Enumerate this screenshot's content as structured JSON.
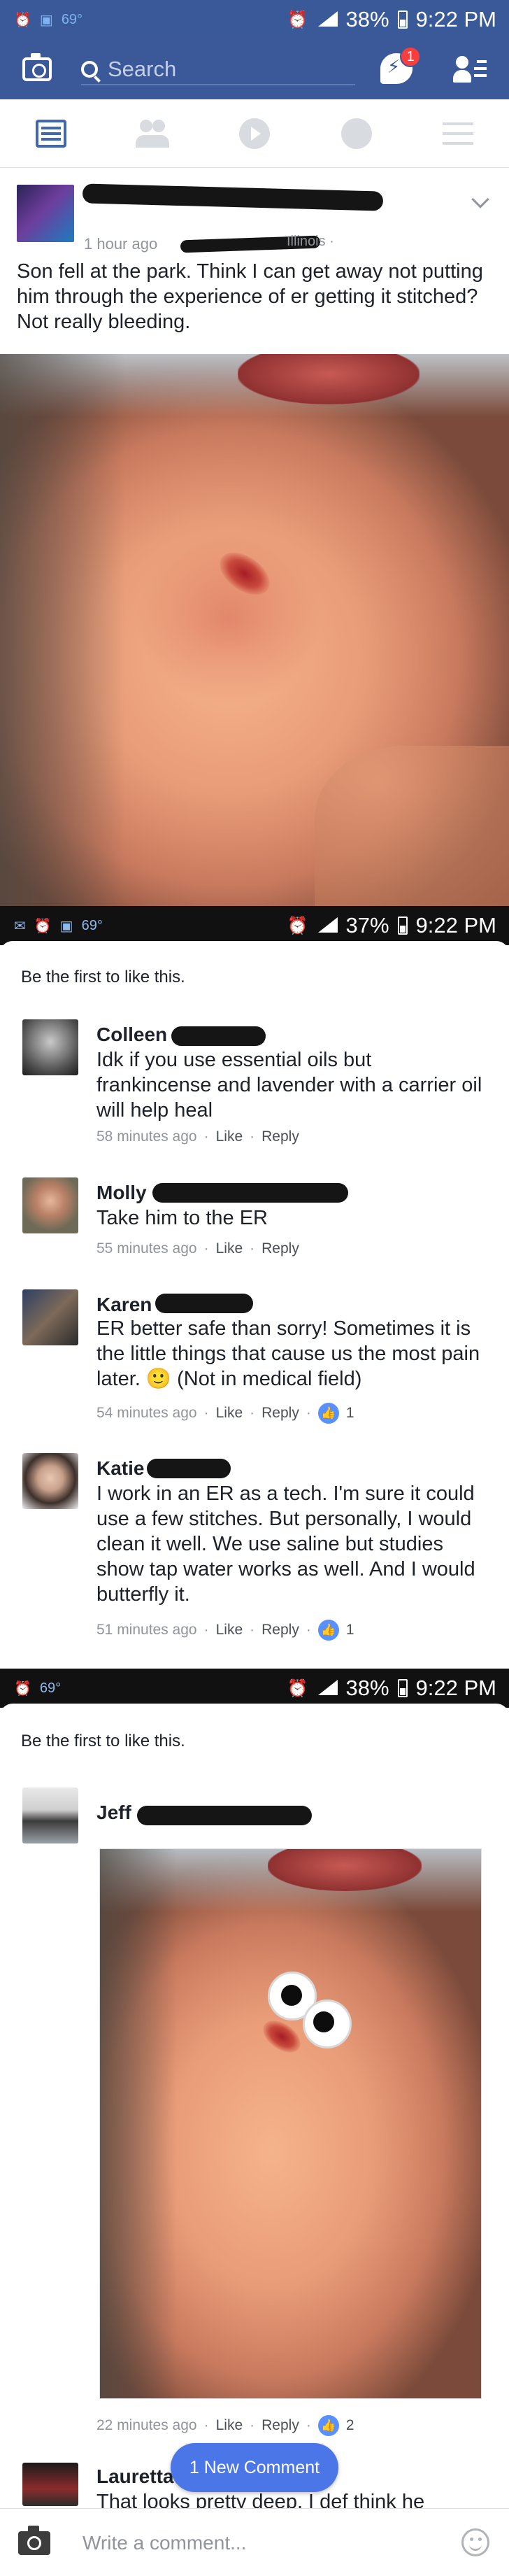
{
  "status_bars": [
    {
      "weather": "69°",
      "battery": "38%",
      "time": "9:22 PM"
    },
    {
      "weather": "69°",
      "battery": "37%",
      "time": "9:22 PM"
    },
    {
      "weather": "69°",
      "battery": "38%",
      "time": "9:22 PM"
    }
  ],
  "header": {
    "search_placeholder": "Search",
    "messenger_badge": "1",
    "brand_color": "#3b5998"
  },
  "tabs": [
    {
      "icon": "news-feed-icon",
      "active": true
    },
    {
      "icon": "friends-icon",
      "active": false
    },
    {
      "icon": "video-icon",
      "active": false
    },
    {
      "icon": "globe-icon",
      "active": false
    },
    {
      "icon": "menu-icon",
      "active": false
    }
  ],
  "post": {
    "time": "1 hour ago",
    "location_tail": "Illinois ·",
    "text": "Son fell at the park. Think I can get away not putting him through the experience of er getting it stitched? Not really bleeding."
  },
  "like_prompt": "Be the first to like this.",
  "comments": [
    {
      "name": "Colleen",
      "text": "Idk if you use essential oils but frankincense and lavender with a carrier oil will help heal",
      "time": "58 minutes ago",
      "like": "Like",
      "reply": "Reply",
      "likes": ""
    },
    {
      "name": "Molly",
      "text": "Take him to the ER",
      "time": "55 minutes ago",
      "like": "Like",
      "reply": "Reply",
      "likes": ""
    },
    {
      "name": "Karen",
      "text": "ER better safe than sorry!  Sometimes it is the little things that cause us the most pain later. 🙂  (Not in medical field)",
      "time": "54 minutes ago",
      "like": "Like",
      "reply": "Reply",
      "likes": "1"
    },
    {
      "name": "Katie",
      "text": "I work in an ER as a tech. I'm sure it could use a few stitches. But personally, I would clean it well. We use saline but studies show tap water works as well. And I would butterfly it.",
      "time": "51 minutes ago",
      "like": "Like",
      "reply": "Reply",
      "likes": "1"
    },
    {
      "name": "Jeff",
      "text": "",
      "time": "22 minutes ago",
      "like": "Like",
      "reply": "Reply",
      "likes": "2"
    },
    {
      "name": "Lauretta",
      "text": "That looks pretty deep. I def think he",
      "time": "",
      "like": "",
      "reply": "",
      "likes": ""
    }
  ],
  "new_comment_pill": "1 New Comment",
  "comment_bar": {
    "placeholder": "Write a comment..."
  }
}
